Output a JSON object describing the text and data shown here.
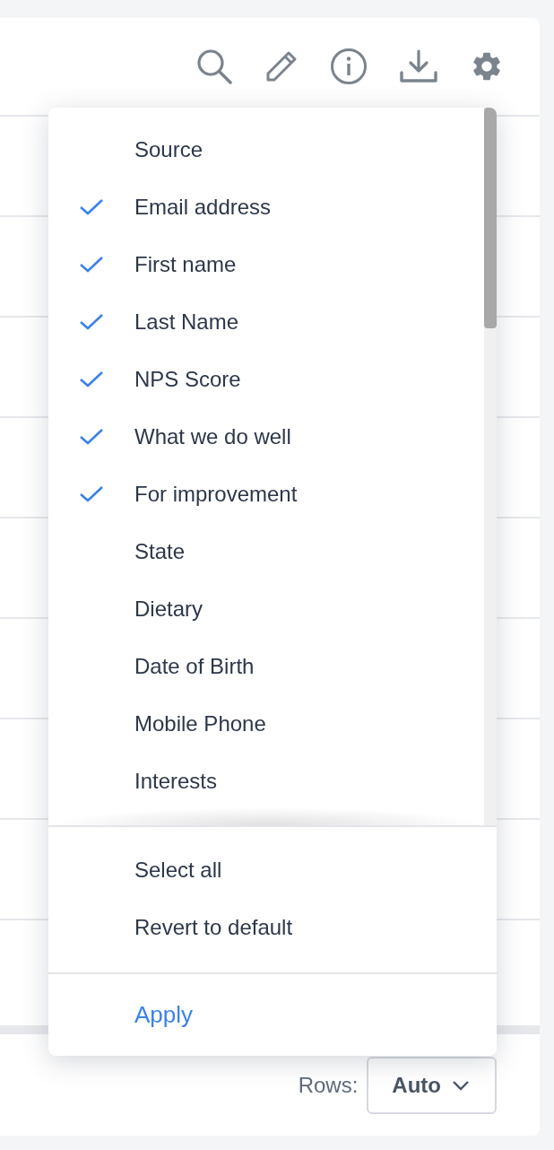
{
  "column_menu": {
    "items": [
      {
        "label": "Source",
        "checked": false
      },
      {
        "label": "Email address",
        "checked": true
      },
      {
        "label": "First name",
        "checked": true
      },
      {
        "label": "Last Name",
        "checked": true
      },
      {
        "label": "NPS Score",
        "checked": true
      },
      {
        "label": "What we do well",
        "checked": true
      },
      {
        "label": "For improvement",
        "checked": true
      },
      {
        "label": "State",
        "checked": false
      },
      {
        "label": "Dietary",
        "checked": false
      },
      {
        "label": "Date of Birth",
        "checked": false
      },
      {
        "label": "Mobile Phone",
        "checked": false
      },
      {
        "label": "Interests",
        "checked": false
      }
    ],
    "actions": [
      "Select all",
      "Revert to default"
    ],
    "apply": "Apply"
  },
  "footer": {
    "rows_label": "Rows:",
    "rows_value": "Auto"
  }
}
